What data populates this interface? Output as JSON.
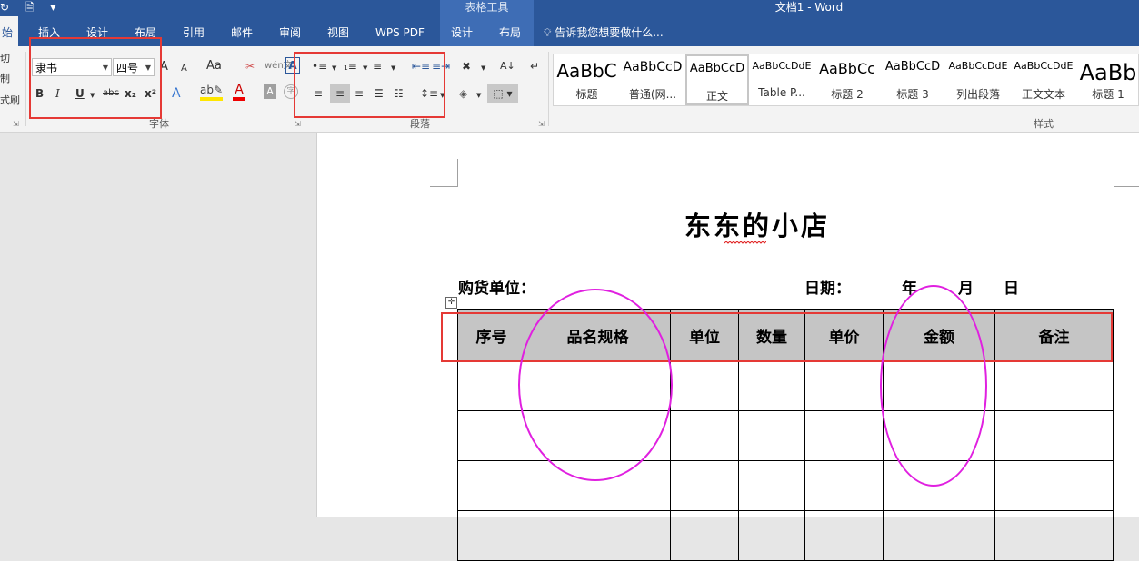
{
  "window": {
    "title": "文档1 - Word",
    "context_header": "表格工具",
    "quick_access_icons": [
      "undo-icon",
      "save-icon",
      "customize-icon"
    ]
  },
  "tabs": [
    {
      "label": "始",
      "active": true
    },
    {
      "label": "插入"
    },
    {
      "label": "设计"
    },
    {
      "label": "布局"
    },
    {
      "label": "引用"
    },
    {
      "label": "邮件"
    },
    {
      "label": "审阅"
    },
    {
      "label": "视图"
    },
    {
      "label": "WPS PDF"
    },
    {
      "label": "设计"
    },
    {
      "label": "布局"
    }
  ],
  "tell_me": "告诉我您想要做什么...",
  "clipboard": {
    "partial_items": [
      "切",
      "制",
      "式刷"
    ]
  },
  "font_group": {
    "label": "字体",
    "font_name": "隶书",
    "font_size": "四号",
    "buttons": {
      "bold": "B",
      "italic": "I",
      "underline": "U",
      "strike": "abc",
      "sub": "x₂",
      "sup": "x²",
      "grow": "A",
      "shrink": "A",
      "case": "Aa",
      "wen": "wén文",
      "bigA": "A"
    }
  },
  "paragraph_group": {
    "label": "段落"
  },
  "styles_group": {
    "label": "样式",
    "items": [
      {
        "sample": "AaBbC",
        "name": "标题",
        "size": 20
      },
      {
        "sample": "AaBbCcD",
        "name": "普通(网...",
        "size": 14
      },
      {
        "sample": "AaBbCcD",
        "name": "正文",
        "size": 13,
        "selected": true
      },
      {
        "sample": "AaBbCcDdE",
        "name": "Table P...",
        "size": 11
      },
      {
        "sample": "AaBbCc",
        "name": "标题 2",
        "size": 16
      },
      {
        "sample": "AaBbCcD",
        "name": "标题 3",
        "size": 13
      },
      {
        "sample": "AaBbCcDdE",
        "name": "列出段落",
        "size": 11
      },
      {
        "sample": "AaBbCcDdE",
        "name": "正文文本",
        "size": 11
      },
      {
        "sample": "AaBb",
        "name": "标题 1",
        "size": 24
      }
    ]
  },
  "document": {
    "title": "东东的小店",
    "buyer_label": "购货单位：",
    "date_label": "日期：",
    "year": "年",
    "month": "月",
    "day": "日",
    "table_headers": [
      "序号",
      "品名规格",
      "单位",
      "数量",
      "单价",
      "金额",
      "备注"
    ],
    "empty_rows": 4
  },
  "annotation_colors": {
    "box": "#e53935",
    "ellipse": "#e020e0"
  }
}
